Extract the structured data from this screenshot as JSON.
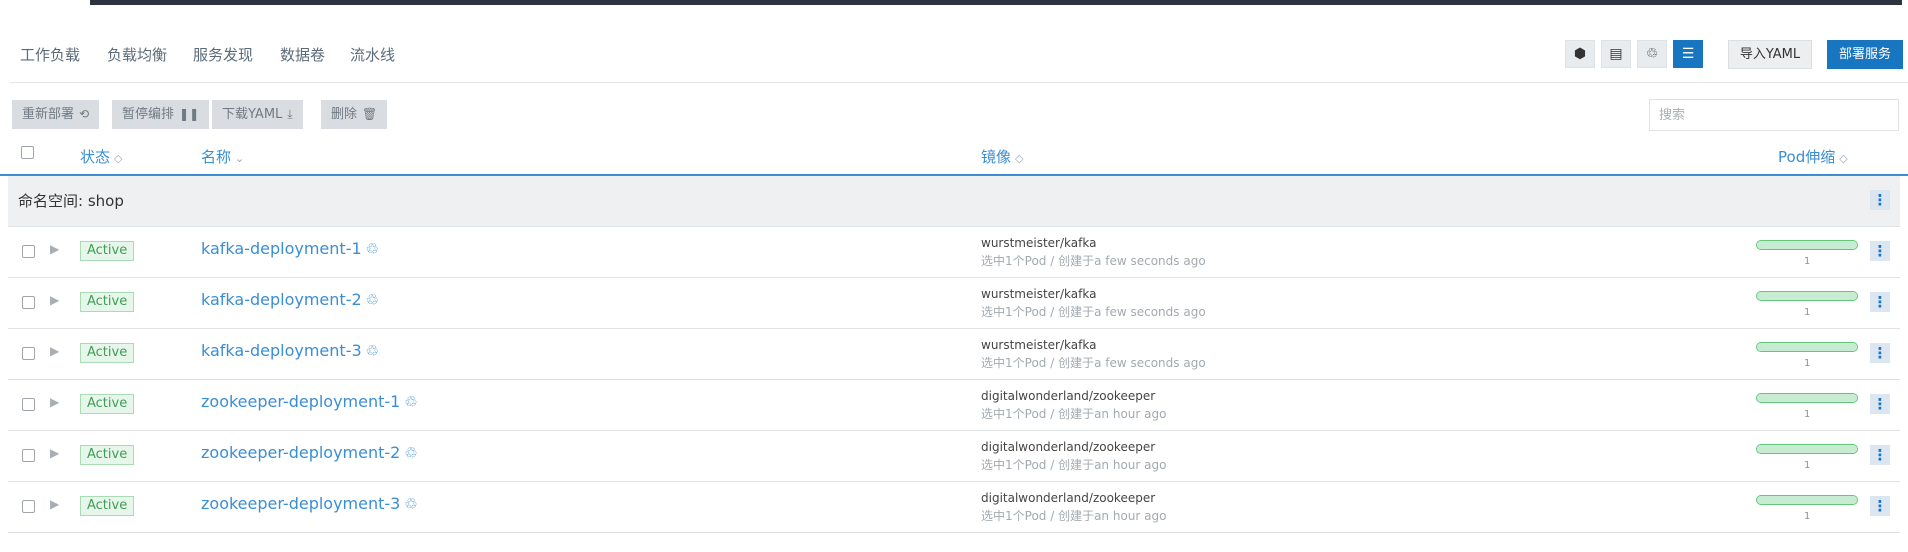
{
  "tabs": [
    {
      "label": "工作负载",
      "active": true
    },
    {
      "label": "负载均衡",
      "active": false
    },
    {
      "label": "服务发现",
      "active": false
    },
    {
      "label": "数据卷",
      "active": false
    },
    {
      "label": "流水线",
      "active": false
    }
  ],
  "view_buttons": [
    {
      "icon": "namespace-icon",
      "glyph": "⬢",
      "active": false
    },
    {
      "icon": "list-icon",
      "glyph": "▤",
      "active": false
    },
    {
      "icon": "node-icon",
      "glyph": "♲",
      "active": false
    },
    {
      "icon": "tree-icon",
      "glyph": "☰",
      "active": true
    }
  ],
  "header_buttons": {
    "import_yaml": "导入YAML",
    "deploy": "部署服务"
  },
  "actions": {
    "redeploy": "重新部署",
    "redeploy_icon": "⟲",
    "pause": "暂停编排",
    "pause_icon": "❚❚",
    "download_yaml": "下载YAML",
    "download_icon": "⤓",
    "delete": "删除",
    "delete_icon": "🗑"
  },
  "search": {
    "placeholder": "搜索"
  },
  "columns": {
    "state": "状态",
    "name": "名称",
    "image": "镜像",
    "scale": "Pod伸缩",
    "sort_glyph": "◇",
    "sort_active_glyph": "⌄"
  },
  "group": {
    "label": "命名空间: shop"
  },
  "colors": {
    "accent": "#1875c0",
    "link": "#3a8ed4",
    "active_badge": "#3f9e55"
  },
  "rows": [
    {
      "state": "Active",
      "name": "kafka-deployment-1",
      "glyph": "♲",
      "image": "wurstmeister/kafka",
      "sub": "选中1个Pod / 创建于a few seconds ago",
      "pods": "1",
      "progress": 1
    },
    {
      "state": "Active",
      "name": "kafka-deployment-2",
      "glyph": "♲",
      "image": "wurstmeister/kafka",
      "sub": "选中1个Pod / 创建于a few seconds ago",
      "pods": "1",
      "progress": 1
    },
    {
      "state": "Active",
      "name": "kafka-deployment-3",
      "glyph": "♲",
      "image": "wurstmeister/kafka",
      "sub": "选中1个Pod / 创建于a few seconds ago",
      "pods": "1",
      "progress": 1
    },
    {
      "state": "Active",
      "name": "zookeeper-deployment-1",
      "glyph": "♲",
      "image": "digitalwonderland/zookeeper",
      "sub": "选中1个Pod / 创建于an hour ago",
      "pods": "1",
      "progress": 1
    },
    {
      "state": "Active",
      "name": "zookeeper-deployment-2",
      "glyph": "♲",
      "image": "digitalwonderland/zookeeper",
      "sub": "选中1个Pod / 创建于an hour ago",
      "pods": "1",
      "progress": 1
    },
    {
      "state": "Active",
      "name": "zookeeper-deployment-3",
      "glyph": "♲",
      "image": "digitalwonderland/zookeeper",
      "sub": "选中1个Pod / 创建于an hour ago",
      "pods": "1",
      "progress": 1
    }
  ]
}
